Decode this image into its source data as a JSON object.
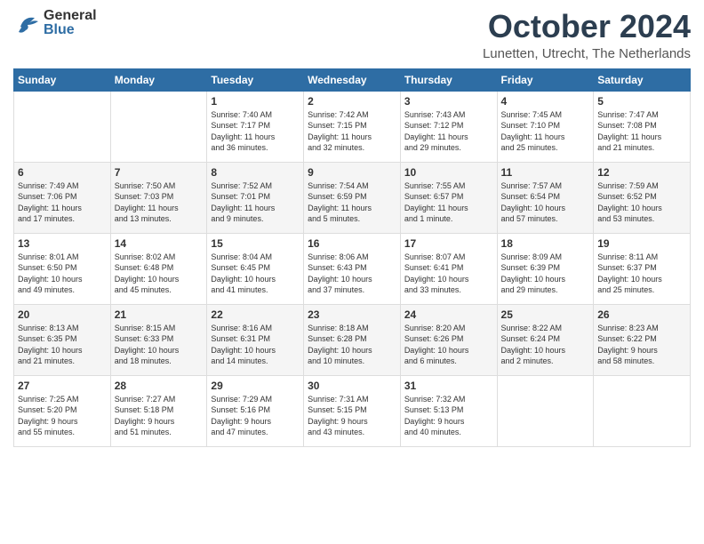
{
  "header": {
    "logo_general": "General",
    "logo_blue": "Blue",
    "month_title": "October 2024",
    "location": "Lunetten, Utrecht, The Netherlands"
  },
  "weekdays": [
    "Sunday",
    "Monday",
    "Tuesday",
    "Wednesday",
    "Thursday",
    "Friday",
    "Saturday"
  ],
  "weeks": [
    [
      {
        "day": "",
        "info": ""
      },
      {
        "day": "",
        "info": ""
      },
      {
        "day": "1",
        "info": "Sunrise: 7:40 AM\nSunset: 7:17 PM\nDaylight: 11 hours\nand 36 minutes."
      },
      {
        "day": "2",
        "info": "Sunrise: 7:42 AM\nSunset: 7:15 PM\nDaylight: 11 hours\nand 32 minutes."
      },
      {
        "day": "3",
        "info": "Sunrise: 7:43 AM\nSunset: 7:12 PM\nDaylight: 11 hours\nand 29 minutes."
      },
      {
        "day": "4",
        "info": "Sunrise: 7:45 AM\nSunset: 7:10 PM\nDaylight: 11 hours\nand 25 minutes."
      },
      {
        "day": "5",
        "info": "Sunrise: 7:47 AM\nSunset: 7:08 PM\nDaylight: 11 hours\nand 21 minutes."
      }
    ],
    [
      {
        "day": "6",
        "info": "Sunrise: 7:49 AM\nSunset: 7:06 PM\nDaylight: 11 hours\nand 17 minutes."
      },
      {
        "day": "7",
        "info": "Sunrise: 7:50 AM\nSunset: 7:03 PM\nDaylight: 11 hours\nand 13 minutes."
      },
      {
        "day": "8",
        "info": "Sunrise: 7:52 AM\nSunset: 7:01 PM\nDaylight: 11 hours\nand 9 minutes."
      },
      {
        "day": "9",
        "info": "Sunrise: 7:54 AM\nSunset: 6:59 PM\nDaylight: 11 hours\nand 5 minutes."
      },
      {
        "day": "10",
        "info": "Sunrise: 7:55 AM\nSunset: 6:57 PM\nDaylight: 11 hours\nand 1 minute."
      },
      {
        "day": "11",
        "info": "Sunrise: 7:57 AM\nSunset: 6:54 PM\nDaylight: 10 hours\nand 57 minutes."
      },
      {
        "day": "12",
        "info": "Sunrise: 7:59 AM\nSunset: 6:52 PM\nDaylight: 10 hours\nand 53 minutes."
      }
    ],
    [
      {
        "day": "13",
        "info": "Sunrise: 8:01 AM\nSunset: 6:50 PM\nDaylight: 10 hours\nand 49 minutes."
      },
      {
        "day": "14",
        "info": "Sunrise: 8:02 AM\nSunset: 6:48 PM\nDaylight: 10 hours\nand 45 minutes."
      },
      {
        "day": "15",
        "info": "Sunrise: 8:04 AM\nSunset: 6:45 PM\nDaylight: 10 hours\nand 41 minutes."
      },
      {
        "day": "16",
        "info": "Sunrise: 8:06 AM\nSunset: 6:43 PM\nDaylight: 10 hours\nand 37 minutes."
      },
      {
        "day": "17",
        "info": "Sunrise: 8:07 AM\nSunset: 6:41 PM\nDaylight: 10 hours\nand 33 minutes."
      },
      {
        "day": "18",
        "info": "Sunrise: 8:09 AM\nSunset: 6:39 PM\nDaylight: 10 hours\nand 29 minutes."
      },
      {
        "day": "19",
        "info": "Sunrise: 8:11 AM\nSunset: 6:37 PM\nDaylight: 10 hours\nand 25 minutes."
      }
    ],
    [
      {
        "day": "20",
        "info": "Sunrise: 8:13 AM\nSunset: 6:35 PM\nDaylight: 10 hours\nand 21 minutes."
      },
      {
        "day": "21",
        "info": "Sunrise: 8:15 AM\nSunset: 6:33 PM\nDaylight: 10 hours\nand 18 minutes."
      },
      {
        "day": "22",
        "info": "Sunrise: 8:16 AM\nSunset: 6:31 PM\nDaylight: 10 hours\nand 14 minutes."
      },
      {
        "day": "23",
        "info": "Sunrise: 8:18 AM\nSunset: 6:28 PM\nDaylight: 10 hours\nand 10 minutes."
      },
      {
        "day": "24",
        "info": "Sunrise: 8:20 AM\nSunset: 6:26 PM\nDaylight: 10 hours\nand 6 minutes."
      },
      {
        "day": "25",
        "info": "Sunrise: 8:22 AM\nSunset: 6:24 PM\nDaylight: 10 hours\nand 2 minutes."
      },
      {
        "day": "26",
        "info": "Sunrise: 8:23 AM\nSunset: 6:22 PM\nDaylight: 9 hours\nand 58 minutes."
      }
    ],
    [
      {
        "day": "27",
        "info": "Sunrise: 7:25 AM\nSunset: 5:20 PM\nDaylight: 9 hours\nand 55 minutes."
      },
      {
        "day": "28",
        "info": "Sunrise: 7:27 AM\nSunset: 5:18 PM\nDaylight: 9 hours\nand 51 minutes."
      },
      {
        "day": "29",
        "info": "Sunrise: 7:29 AM\nSunset: 5:16 PM\nDaylight: 9 hours\nand 47 minutes."
      },
      {
        "day": "30",
        "info": "Sunrise: 7:31 AM\nSunset: 5:15 PM\nDaylight: 9 hours\nand 43 minutes."
      },
      {
        "day": "31",
        "info": "Sunrise: 7:32 AM\nSunset: 5:13 PM\nDaylight: 9 hours\nand 40 minutes."
      },
      {
        "day": "",
        "info": ""
      },
      {
        "day": "",
        "info": ""
      }
    ]
  ]
}
